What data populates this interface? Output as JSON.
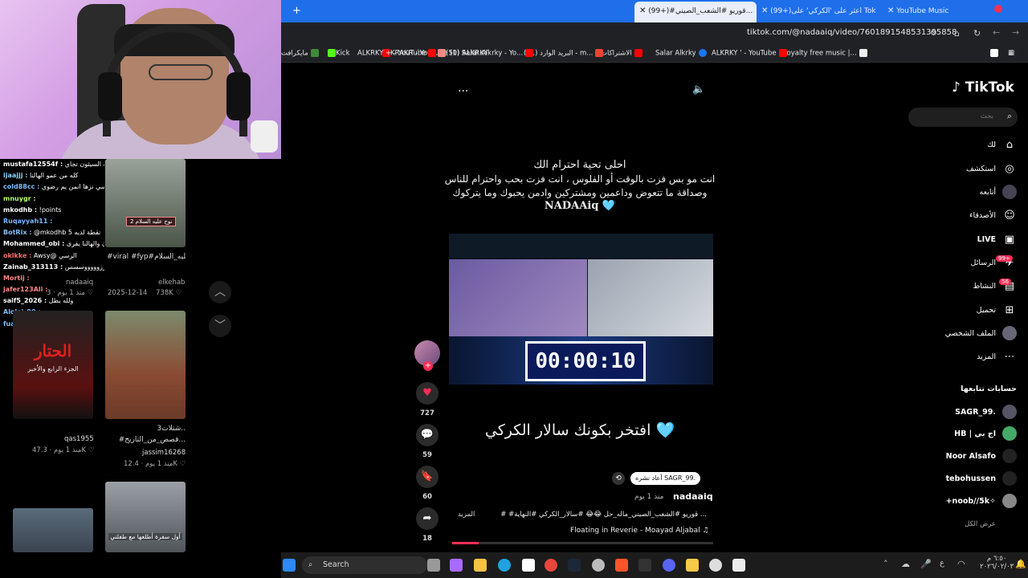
{
  "browser": {
    "tabs": [
      {
        "label": "YouTube Music"
      },
      {
        "label": "(99+)اعثر على 'الكركي' على Tok"
      },
      {
        "label": "(99+)#قوريو #الشعب_الصيني..."
      }
    ],
    "url": "tiktok.com/@nadaaiq/video/7601891548531395858",
    "bookmarks": [
      "Royalty free music |...",
      "ALKRKY ' - YouTube",
      "Salar Alkrky",
      "الاشتراكات",
      "البريد الوارد (11) - m...",
      "(1) Salar Alkrky - Yo...",
      "KRAKR - YouTube",
      "(50) ALKRKY",
      "ALKRKY + - YouTube",
      "Kick",
      "مايكرافت"
    ]
  },
  "chat": [
    {
      "user": "mustafa12554f :",
      "msg": "شوكت السيثون تجاي",
      "color": "#fff"
    },
    {
      "user": "ijaajjj :",
      "msg": "كله من عمو الهالنا",
      "color": "#8bd3ff"
    },
    {
      "user": "cold88cc :",
      "msg": "نفسها اسي نزها انمن يم رضوي",
      "color": "#7fbfff"
    },
    {
      "user": "mnuygr :",
      "msg": "",
      "color": "#b3ff66"
    },
    {
      "user": "mkodhb :",
      "msg": "!points",
      "color": "#fff"
    },
    {
      "user": "Ruqayyah11 :",
      "msg": "",
      "color": "#77b6ff"
    },
    {
      "user": "BotRix :",
      "msg": "@mkodhb 5 نقطة لديه",
      "color": "#7fbfff"
    },
    {
      "user": "Mohammed_obi :",
      "msg": "أمير ون والهالنا يقرى!",
      "color": "#fff"
    },
    {
      "user": "oklkke :",
      "msg": "Awsy@ الرسي",
      "color": "#ff6b6b"
    },
    {
      "user": "Zainab_313113 :",
      "msg": "الختتززوووووسسس",
      "color": "#fff"
    },
    {
      "user": "Mortij :",
      "msg": "",
      "color": "#ff8888"
    },
    {
      "user": "jafer123Ali :",
      "msg": "",
      "color": "#ff8888"
    },
    {
      "user": "saif5_2026 :",
      "msg": "ولله يطل",
      "color": "#fff"
    },
    {
      "user": "Aloloi_90 :",
      "msg": "",
      "color": "#7fbfff"
    },
    {
      "user": "fuawz :",
      "msg": "",
      "color": "#7fbfff"
    }
  ],
  "grid": [
    {
      "caption": "#viral #fyp#الكسلوي #نوح_عليه_السلام",
      "author": "elkehab",
      "date": "2025-12-14",
      "views": "738K",
      "badge": "نوح عليه السلام 2"
    },
    {
      "caption": "",
      "author": "nadaaiq",
      "date": "منذ 1 يوم",
      "views": "3",
      "badge": ""
    },
    {
      "caption": "3شتلات..",
      "caption2": "#قصص_من_التاريخ...",
      "author": "jassim16268",
      "date": "منذ 1 يوم",
      "views": "12.4K"
    },
    {
      "caption": "",
      "author": "qas1955",
      "date": "منذ 1 يوم",
      "views": "47.3K",
      "poster_title": "الحتار",
      "poster_sub": "الجزء الرابع والأخير"
    },
    {
      "caption": "أول سفرة أطلعها مع طفلتي",
      "author": "",
      "date": "",
      "views": ""
    }
  ],
  "video": {
    "line1": "احلى تحية احترام الك",
    "line2": "انت مو بس فزت بالوقت أو الفلوس ، انت فزت بحب واحترام للناس",
    "line3": "وصداقة ما تتعوض وداعمين ومشتركين وادمن يحبوك وما يتركوك",
    "line4": "NADAAiq 🩵",
    "timer": "00:00:10",
    "bottom_text": "افتخر بكونك سالار الكركي 🩵"
  },
  "actions": {
    "likes": "727",
    "comments": "59",
    "saves": "60",
    "shares": "18"
  },
  "post": {
    "repost_label": "أعاد نشره",
    "repost_user": "SAGR_99.",
    "author": "nadaaiq",
    "time": "منذ 1 يوم",
    "description": "# #قوريو #الشعب_الصيني_ماله_حل 😂😂 #سالار_الكركي #النهاية ...",
    "more": "المزيد",
    "music": "Floating in Reverie - Moayad Aljabal"
  },
  "sidebar": {
    "brand": "TikTok",
    "search_placeholder": "بحث",
    "items": [
      {
        "label": "لك",
        "icon": "home-icon"
      },
      {
        "label": "استكشف",
        "icon": "compass-icon"
      },
      {
        "label": "أتابعه",
        "icon": "following-icon"
      },
      {
        "label": "الأصدقاء",
        "icon": "friends-icon"
      },
      {
        "label": "LIVE",
        "icon": "live-icon"
      },
      {
        "label": "الرسائل",
        "icon": "messages-icon",
        "badge": "99+"
      },
      {
        "label": "النشاط",
        "icon": "activity-icon",
        "badge": "56"
      },
      {
        "label": "تحميل",
        "icon": "upload-icon"
      },
      {
        "label": "الملف الشخصي",
        "icon": "profile-icon"
      },
      {
        "label": "المزيد",
        "icon": "more-icon"
      }
    ],
    "following_title": "حسابات تتابعها",
    "following": [
      "SAGR_99.",
      "HB | اج بي",
      "Noor Alsafo",
      "tebohussen",
      "+noob//5k✧"
    ],
    "see_all": "عرض الكل"
  },
  "taskbar": {
    "search": "Search",
    "clock_time": "٦:٥٠ م",
    "clock_date": "٢٠٢٦/٠٢/٠٣"
  },
  "colors": {
    "accent": "#fe2c55",
    "tab_blue": "#1f6feb",
    "timer_bg": "#0a1a5a",
    "heart_blue": "#74c7e8"
  }
}
